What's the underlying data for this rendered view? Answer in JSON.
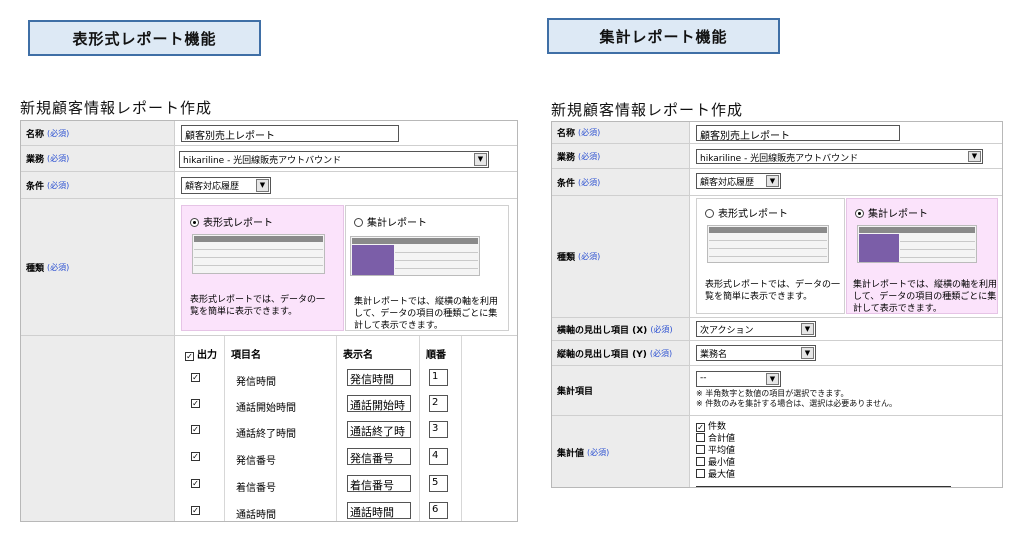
{
  "left": {
    "tag": "表形式レポート機能",
    "heading": "新規顧客情報レポート作成",
    "name_label": "名称",
    "name_value": "顧客別売上レポート",
    "business_label": "業務",
    "business_value": "hikariline - 光回線販売アウトバウンド",
    "condition_label": "条件",
    "condition_value": "顧客対応履歴",
    "type_label": "種類",
    "required": "必須",
    "choice_tabular_title": "表形式レポート",
    "choice_tabular_desc": [
      "表形式レポートでは、データの一",
      "覧を簡単に表示できます。"
    ],
    "choice_summary_title": "集計レポート",
    "choice_summary_desc": [
      "集計レポートでは、縦横の軸を利用",
      "して、データの項目の種類ごとに集",
      "計して表示できます。"
    ],
    "col_output": "出力",
    "col_item": "項目名",
    "col_display": "表示名",
    "col_order": "順番",
    "fields": [
      {
        "item": "発信時間",
        "display": "発信時間",
        "order": "1"
      },
      {
        "item": "通話開始時間",
        "display": "通話開始時",
        "order": "2"
      },
      {
        "item": "通話終了時間",
        "display": "通話終了時",
        "order": "3"
      },
      {
        "item": "発信番号",
        "display": "発信番号",
        "order": "4"
      },
      {
        "item": "着信番号",
        "display": "着信番号",
        "order": "5"
      },
      {
        "item": "通話時間",
        "display": "通話時間",
        "order": "6"
      }
    ]
  },
  "right": {
    "tag": "集計レポート機能",
    "heading": "新規顧客情報レポート作成",
    "name_label": "名称",
    "name_value": "顧客別売上レポート",
    "business_label": "業務",
    "business_value": "hikariline - 光回線販売アウトバウンド",
    "condition_label": "条件",
    "condition_value": "顧客対応履歴",
    "type_label": "種類",
    "required": "必須",
    "choice_tabular_title": "表形式レポート",
    "choice_tabular_desc": [
      "表形式レポートでは、データの一",
      "覧を簡単に表示できます。"
    ],
    "choice_summary_title": "集計レポート",
    "choice_summary_desc": [
      "集計レポートでは、縦横の軸を利用",
      "して、データの項目の種類ごとに集",
      "計して表示できます。"
    ],
    "horiz_label": "横軸の見出し項目 (X)",
    "horiz_value": "次アクション",
    "vert_label": "縦軸の見出し項目 (Y)",
    "vert_value": "業務名",
    "agg_item_label": "集計項目",
    "agg_item_value": "--",
    "agg_notes": [
      "※ 半角数字と数値の項目が選択できます。",
      "※ 件数のみを集計する場合は、選択は必要ありません。"
    ],
    "agg_value_label": "集計値",
    "agg_options": [
      {
        "label": "件数",
        "checked": "✓"
      },
      {
        "label": "合計値",
        "checked": ""
      },
      {
        "label": "平均値",
        "checked": ""
      },
      {
        "label": "最小値",
        "checked": ""
      },
      {
        "label": "最大値",
        "checked": ""
      }
    ]
  },
  "check_mark": "✓",
  "caret": "▼"
}
